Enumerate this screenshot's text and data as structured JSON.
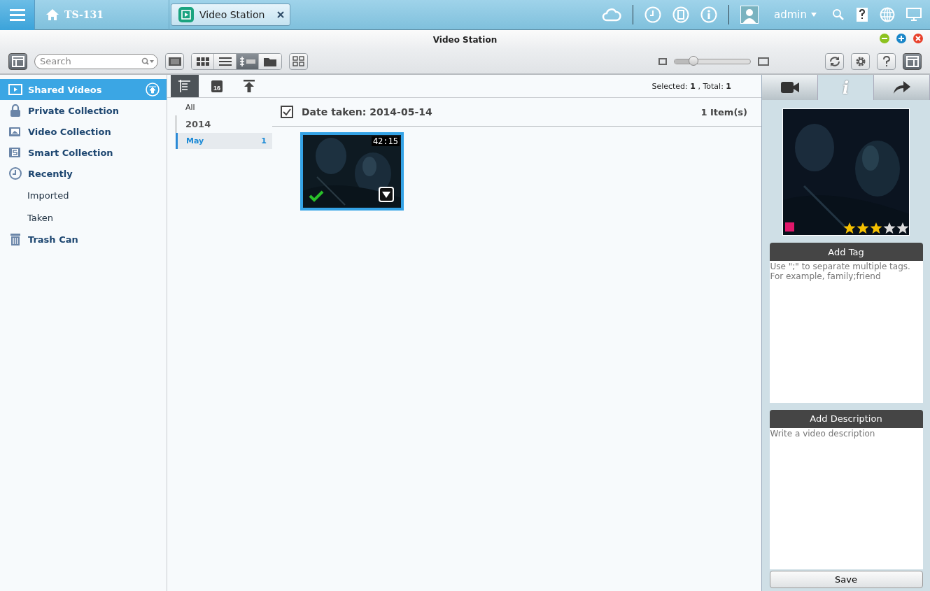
{
  "topbar": {
    "host": "TS-131",
    "app_tab": {
      "label": "Video Station",
      "selected": true
    },
    "user": "admin"
  },
  "window": {
    "title": "Video Station"
  },
  "toolbar": {
    "search": {
      "placeholder": "Search"
    },
    "view_modes": [
      {
        "kind": "grid",
        "selected": false
      },
      {
        "kind": "list",
        "selected": false
      },
      {
        "kind": "timeline",
        "selected": true
      },
      {
        "kind": "folder",
        "selected": false
      }
    ],
    "size_slider": {
      "level": 0.25
    },
    "panel_toggle": {
      "on": true
    }
  },
  "sidebar": {
    "items": [
      {
        "label": "Shared Videos",
        "kind": "shared",
        "selected": true
      },
      {
        "label": "Private Collection",
        "kind": "private",
        "selected": false
      },
      {
        "label": "Video Collection",
        "kind": "collection",
        "selected": false
      },
      {
        "label": "Smart Collection",
        "kind": "smart",
        "selected": false
      },
      {
        "label": "Recently",
        "kind": "recent",
        "selected": false,
        "children": [
          {
            "label": "Imported",
            "selected": false
          },
          {
            "label": "Taken",
            "selected": false
          }
        ]
      },
      {
        "label": "Trash Can",
        "kind": "trash",
        "selected": false
      }
    ]
  },
  "nav_tabs": [
    {
      "kind": "timeline",
      "selected": true
    },
    {
      "kind": "calendar",
      "label": "16",
      "selected": false
    },
    {
      "kind": "upload",
      "selected": false
    }
  ],
  "status": {
    "selected_label": "Selected:",
    "selected": "1",
    "total_label": ", Total:",
    "total": "1"
  },
  "timeline": {
    "all": "All",
    "years": [
      {
        "label": "2014",
        "months": [
          {
            "label": "May",
            "count": "1",
            "selected": true
          }
        ]
      }
    ]
  },
  "group": {
    "title": "Date taken: 2014-05-14",
    "checked": true,
    "count": "1 Item(s)",
    "videos": [
      {
        "duration": "42:15",
        "selected": true
      }
    ]
  },
  "info_panel": {
    "tabs": [
      {
        "kind": "video",
        "selected": false
      },
      {
        "kind": "info",
        "label": "i",
        "selected": true
      },
      {
        "kind": "share",
        "selected": false
      }
    ],
    "color": "#e0176a",
    "stars": 3,
    "tag": {
      "title": "Add Tag",
      "placeholder": "Use \";\" to separate multiple tags.\nFor example, family;friend"
    },
    "description": {
      "title": "Add Description",
      "placeholder": "Write a video description"
    },
    "save": "Save"
  }
}
